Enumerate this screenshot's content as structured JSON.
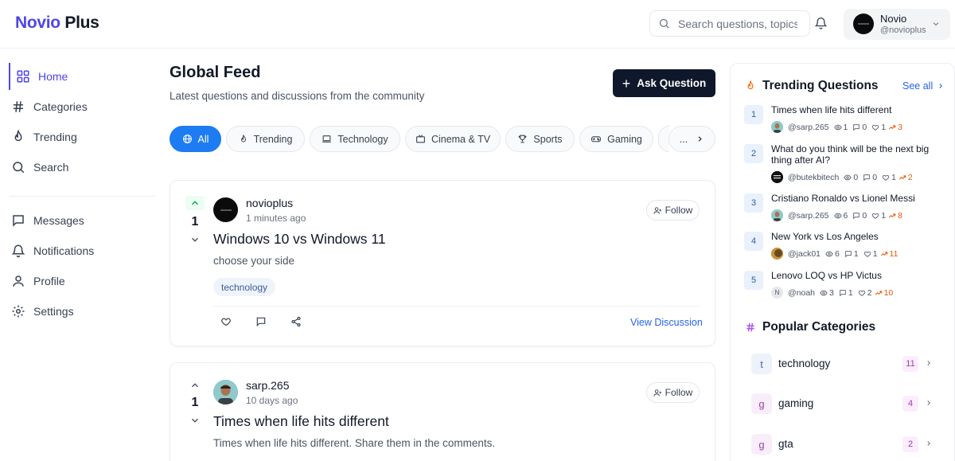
{
  "app": {
    "logo_part1": "Novio",
    "logo_part2": "Plus"
  },
  "header": {
    "search_placeholder": "Search questions, topics",
    "user": {
      "name": "Novio",
      "handle": "@novioplus"
    }
  },
  "sidebar": {
    "items": [
      {
        "label": "Home",
        "icon": "grid-icon",
        "active": true
      },
      {
        "label": "Categories",
        "icon": "hash-icon"
      },
      {
        "label": "Trending",
        "icon": "flame-icon"
      },
      {
        "label": "Search",
        "icon": "search-icon"
      },
      {
        "label": "Messages",
        "icon": "message-icon"
      },
      {
        "label": "Notifications",
        "icon": "bell-icon"
      },
      {
        "label": "Profile",
        "icon": "user-icon"
      },
      {
        "label": "Settings",
        "icon": "gear-icon"
      }
    ]
  },
  "feed": {
    "title": "Global Feed",
    "subtitle": "Latest questions and discussions from the community",
    "ask_label": "Ask Question",
    "chips": [
      {
        "label": "All",
        "icon": "globe-icon",
        "active": true
      },
      {
        "label": "Trending",
        "icon": "flame-icon"
      },
      {
        "label": "Technology",
        "icon": "laptop-icon"
      },
      {
        "label": "Cinema & TV",
        "icon": "tv-icon"
      },
      {
        "label": "Sports",
        "icon": "trophy-icon"
      },
      {
        "label": "Gaming",
        "icon": "gamepad-icon"
      }
    ],
    "more_chip_label": "...",
    "posts": [
      {
        "votes": "1",
        "author": "novioplus",
        "time": "1 minutes ago",
        "follow_label": "Follow",
        "title": "Windows 10 vs Windows 11",
        "body": "choose your side",
        "tag": "technology",
        "view_label": "View Discussion"
      },
      {
        "votes": "1",
        "author": "sarp.265",
        "time": "10 days ago",
        "follow_label": "Follow",
        "title": "Times when life hits different",
        "body": "Times when life hits different. Share them in the comments."
      }
    ]
  },
  "trending": {
    "title": "Trending Questions",
    "see_all": "See all",
    "items": [
      {
        "rank": "1",
        "title": "Times when life hits different",
        "user": "@sarp.265",
        "views": "1",
        "comments": "0",
        "likes": "1",
        "trend": "3"
      },
      {
        "rank": "2",
        "title": "What do you think will be the next big thing after AI?",
        "user": "@butekbitech",
        "views": "0",
        "comments": "0",
        "likes": "1",
        "trend": "2"
      },
      {
        "rank": "3",
        "title": "Cristiano Ronaldo vs Lionel Messi",
        "user": "@sarp.265",
        "views": "6",
        "comments": "0",
        "likes": "1",
        "trend": "8"
      },
      {
        "rank": "4",
        "title": "New York vs Los Angeles",
        "user": "@jack01",
        "views": "6",
        "comments": "1",
        "likes": "1",
        "trend": "11"
      },
      {
        "rank": "5",
        "title": "Lenovo LOQ vs HP Victus",
        "user": "@noah",
        "avatar_letter": "N",
        "views": "3",
        "comments": "1",
        "likes": "2",
        "trend": "10"
      }
    ]
  },
  "categories": {
    "title": "Popular Categories",
    "items": [
      {
        "letter": "t",
        "name": "technology",
        "count": "11",
        "color": "#eef2fb",
        "text_color": "#4b6aa8"
      },
      {
        "letter": "g",
        "name": "gaming",
        "count": "4",
        "color": "#f8eef9",
        "text_color": "#9c3fb0"
      },
      {
        "letter": "g",
        "name": "gta",
        "count": "2",
        "color": "#f8eef9",
        "text_color": "#9c3fb0"
      }
    ]
  },
  "colors": {
    "accent": "#4f46e5",
    "chip_active": "#1d7cf2",
    "link": "#2563eb",
    "trend": "#ea580c",
    "dark_button": "#0f172a"
  }
}
